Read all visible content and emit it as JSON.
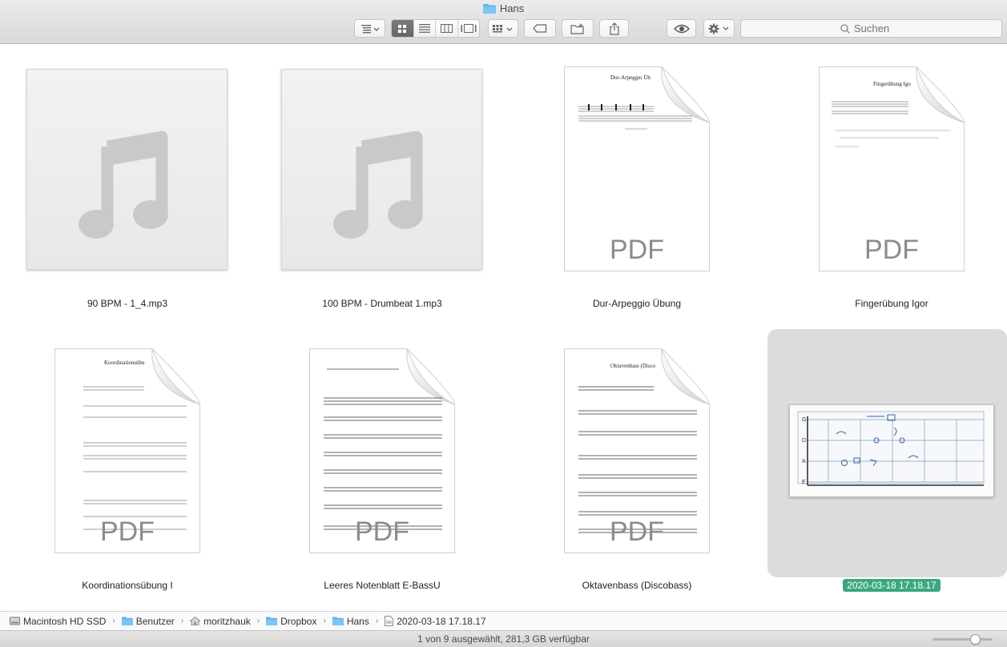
{
  "window": {
    "title": "Hans"
  },
  "toolbar": {
    "search_placeholder": "Suchen"
  },
  "files": [
    {
      "name": "90 BPM - 1_4.mp3",
      "kind": "audio"
    },
    {
      "name": "100 BPM - Drumbeat 1.mp3",
      "kind": "audio"
    },
    {
      "name": "Dur-Arpeggio Übung",
      "kind": "pdf",
      "page_title": "Dur-Arpeggio Üb",
      "badge": "PDF"
    },
    {
      "name": "Fingerübung Igor",
      "kind": "pdf",
      "page_title": "Fingerübung Igo",
      "badge": "PDF"
    },
    {
      "name": "Koordinationsübung I",
      "kind": "pdf",
      "page_title": "Koordinationsübu",
      "badge": "PDF"
    },
    {
      "name": "Leeres Notenblatt E-BassU",
      "kind": "pdf",
      "page_title": "",
      "badge": "PDF"
    },
    {
      "name": "Oktavenbass (Discobass)",
      "kind": "pdf",
      "page_title": "Oktavenbass (Disco",
      "badge": "PDF"
    },
    {
      "name": "2020-03-18 17.18.17",
      "kind": "image",
      "selected": true,
      "string_labels": [
        "G",
        "D",
        "A",
        "E"
      ]
    }
  ],
  "pathbar": [
    {
      "label": "Macintosh HD SSD",
      "icon": "harddrive-icon"
    },
    {
      "label": "Benutzer",
      "icon": "folder-icon"
    },
    {
      "label": "moritzhauk",
      "icon": "home-icon"
    },
    {
      "label": "Dropbox",
      "icon": "folder-icon"
    },
    {
      "label": "Hans",
      "icon": "folder-icon"
    },
    {
      "label": "2020-03-18 17.18.17",
      "icon": "file-icon"
    }
  ],
  "status": {
    "text": "1 von 9 ausgewählt, 281,3 GB verfügbar",
    "zoom": 0.75
  },
  "colors": {
    "selection": "#3aa87f",
    "folder": "#5fb4ef",
    "active_view": "#6f6f6f"
  }
}
